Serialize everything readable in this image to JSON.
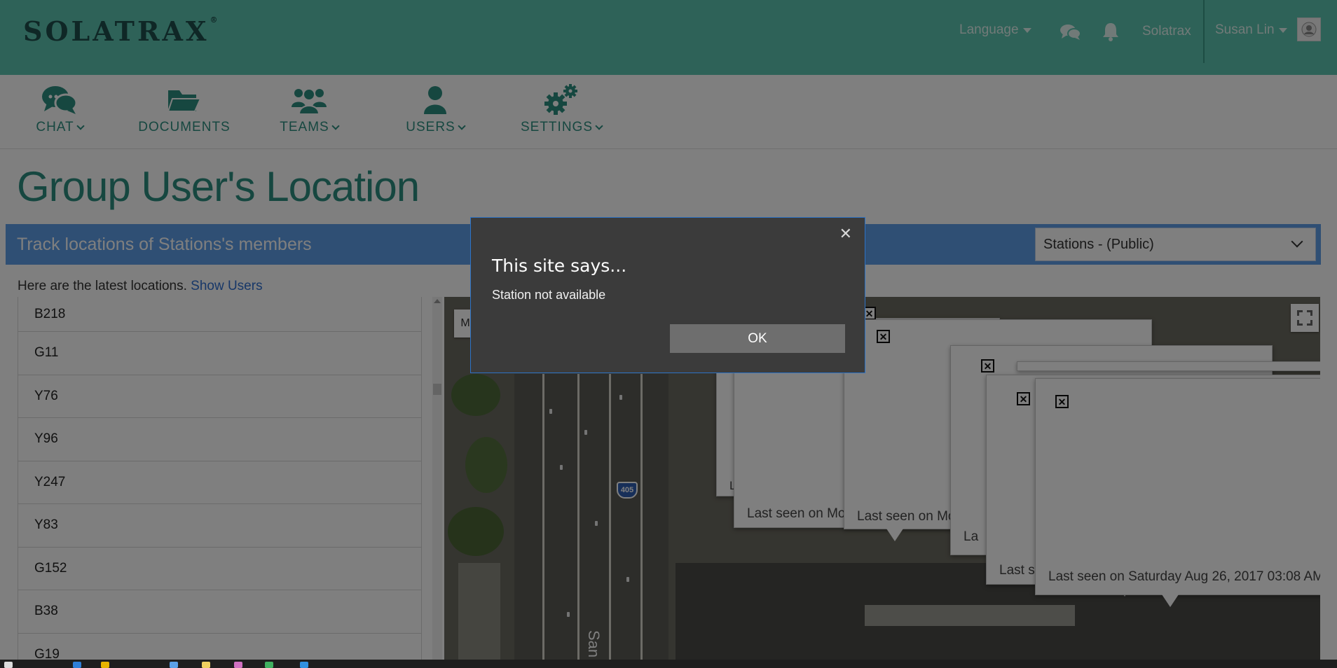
{
  "header": {
    "logo_text": "SOLATRAX",
    "logo_mark": "®",
    "language_label": "Language",
    "chat_icon": "comments-icon",
    "notification_icon": "bell-icon",
    "org_label": "Solatrax",
    "user_name": "Susan Lin",
    "avatar_icon": "avatar-icon"
  },
  "modules": [
    {
      "label": "CHAT",
      "icon": "comments-icon"
    },
    {
      "label": "DOCUMENTS",
      "icon": "folder-open-icon"
    },
    {
      "label": "TEAMS",
      "icon": "users-icon"
    },
    {
      "label": "USERS",
      "icon": "user-icon"
    },
    {
      "label": "SETTINGS",
      "icon": "gears-icon"
    }
  ],
  "page": {
    "title": "Group User's Location",
    "panel_title": "Track locations of Stations's members",
    "group_select_value": "Stations - (Public)",
    "latest_text": "Here are the latest locations.",
    "show_users_link": "Show Users"
  },
  "users": [
    "B218",
    "G11",
    "Y76",
    "Y96",
    "Y247",
    "Y83",
    "G152",
    "B38",
    "G19"
  ],
  "map": {
    "highway_shield": "405",
    "street_label": "San",
    "type_button_label": "M",
    "popups": [
      "Last seen on Mo",
      "Last seen on Mo",
      "La",
      "Last s",
      "Last seen on Saturday Aug 26, 2017 03:08 AM"
    ],
    "fragment_label": "L"
  },
  "dialog": {
    "title": "This site says...",
    "message": "Station not available",
    "ok_label": "OK",
    "close_glyph": "✕"
  },
  "colors": {
    "header_bg": "#5cc4b0",
    "accent": "#2d8f80",
    "panel_bg": "#5f9fe8",
    "link": "#2f6fd1",
    "dialog_bg": "#3b3b3b"
  }
}
